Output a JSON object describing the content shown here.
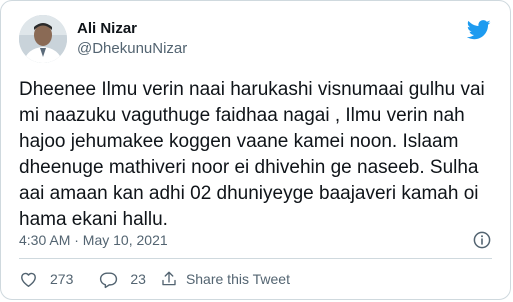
{
  "author": {
    "name": "Ali Nizar",
    "handle": "@DhekunuNizar"
  },
  "tweet": {
    "text": "Dheenee Ilmu verin naai harukashi visnumaai gulhu vai mi naazuku vaguthuge faidhaa nagai , Ilmu verin nah hajoo jehumakee koggen vaane kamei noon. Islaam dheenuge mathiveri noor ei dhivehin ge naseeb. Sulha aai amaan kan adhi 02 dhuniyeyge baajaveri kamah oi hama ekani hallu.",
    "timestamp": "4:30 AM · May 10, 2021"
  },
  "actions": {
    "like_count": "273",
    "reply_count": "23",
    "share_label": "Share this Tweet"
  },
  "icons": {
    "brand": "twitter-bird-icon",
    "info": "info-icon",
    "like": "heart-icon",
    "reply": "reply-icon",
    "share": "share-icon"
  },
  "colors": {
    "brand": "#1d9bf0",
    "text": "#0f1419",
    "secondary": "#536471",
    "border": "#cfd9de"
  }
}
